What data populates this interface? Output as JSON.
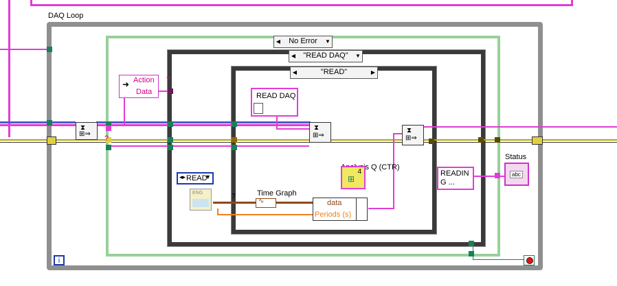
{
  "daq_loop": {
    "label": "DAQ Loop"
  },
  "case_outer": {
    "selected": "No Error"
  },
  "case_middle": {
    "selected": "\"READ DAQ\""
  },
  "case_inner": {
    "selected": "\"READ\""
  },
  "unbundle": {
    "field1": "Action",
    "field2": "Data"
  },
  "read_daq_node": {
    "label": "READ DAQ"
  },
  "enum_read": {
    "value": "READ"
  },
  "time_graph": {
    "label": "Time Graph"
  },
  "bundle": {
    "field1": "data",
    "field2": "Periods (s)"
  },
  "analysis_queue": {
    "label": "Analysis Q (CTR)",
    "value": "4"
  },
  "reading_const": {
    "text": "READIN G ..."
  },
  "status": {
    "label": "Status",
    "icon_text": "abc"
  },
  "iteration": {
    "glyph": "i"
  },
  "colors": {
    "wire_cluster": "#e23cd6",
    "wire_error": "#b8a600",
    "wire_dbl": "#f08020",
    "loop_border": "#8f8f8f",
    "case_border": "#99d099",
    "stop_red": "#d81818"
  }
}
